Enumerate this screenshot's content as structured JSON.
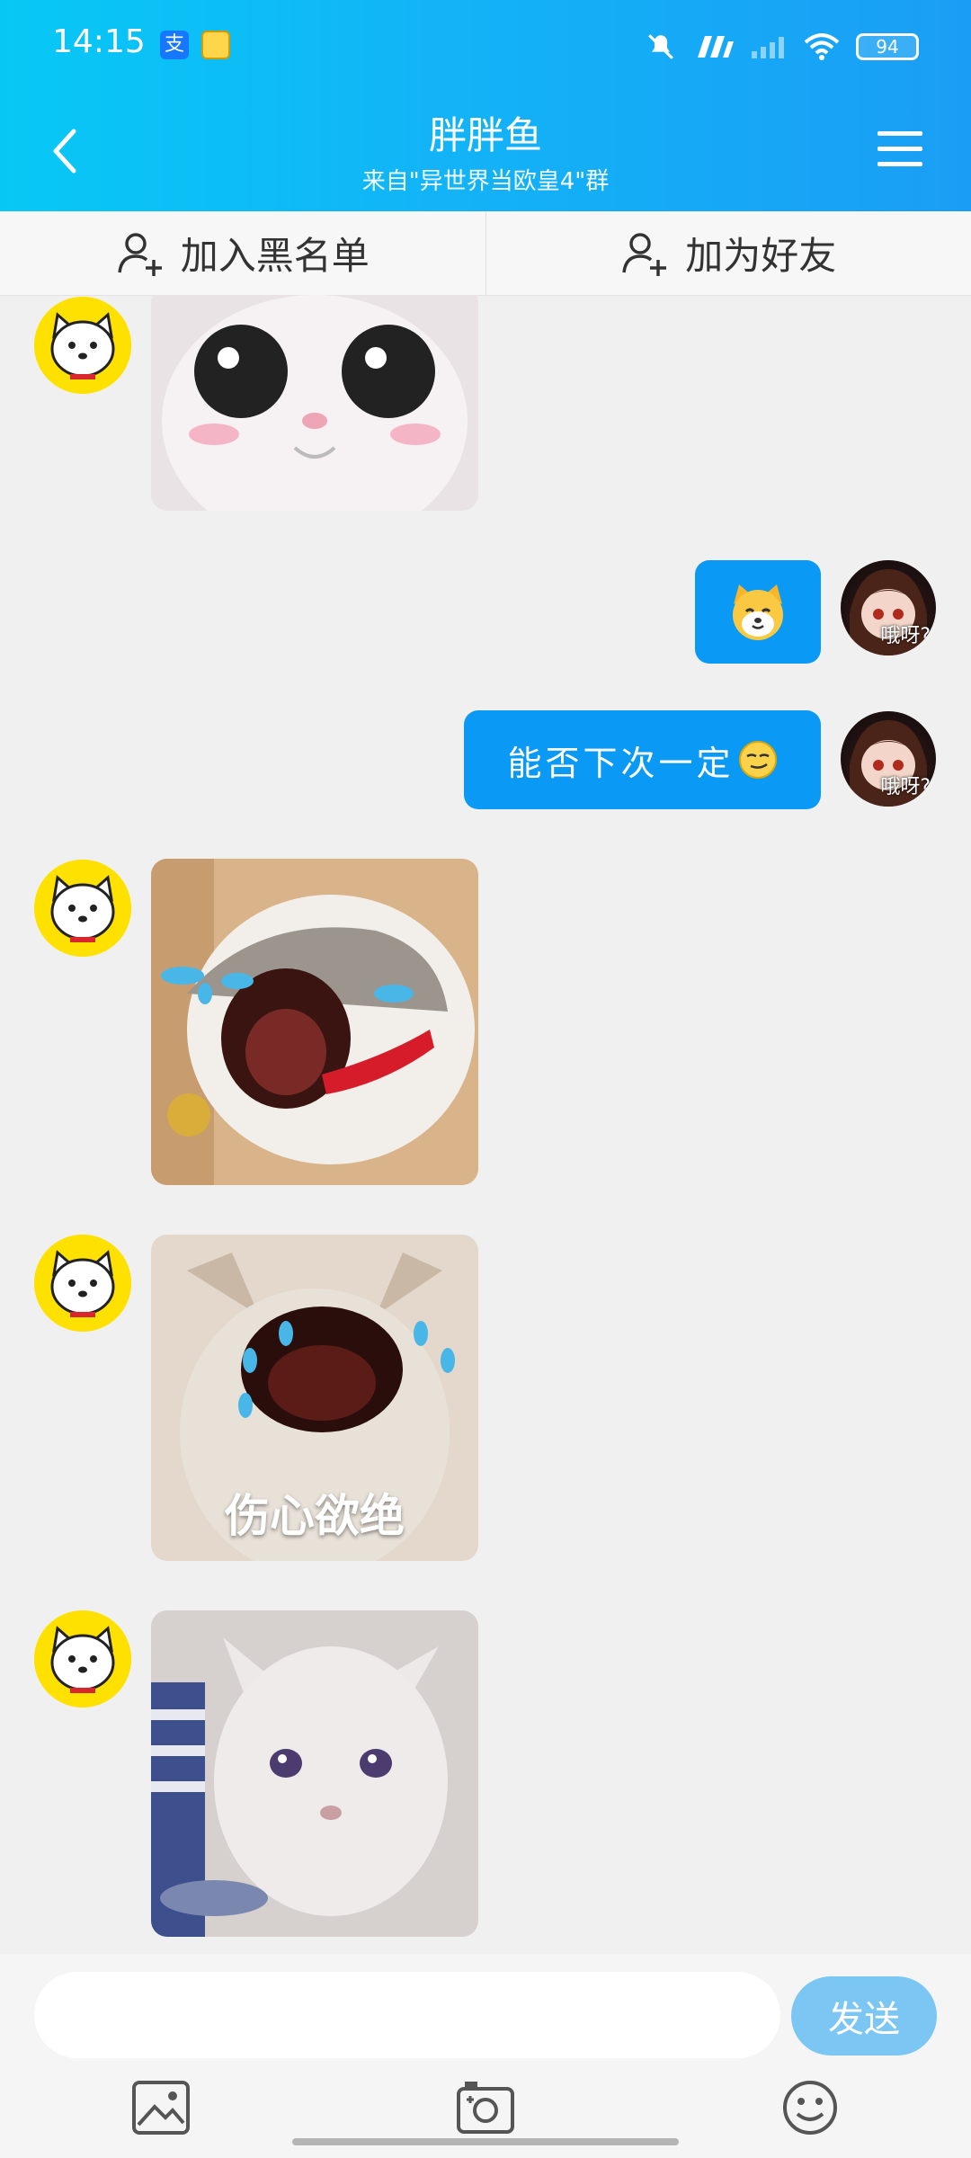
{
  "status_bar": {
    "time": "14:15",
    "battery": "94"
  },
  "header": {
    "title": "胖胖鱼",
    "subtitle": "来自\"异世界当欧皇4\"群",
    "back_icon": "chevron-left-icon",
    "menu_icon": "hamburger-menu-icon"
  },
  "actions": {
    "blacklist_label": "加入黑名单",
    "add_friend_label": "加为好友"
  },
  "messages": [
    {
      "sender": "other",
      "type": "image",
      "subject": "cat with big eyes"
    },
    {
      "sender": "self",
      "type": "sticker",
      "subject": "smiling yellow cat emoji"
    },
    {
      "sender": "self",
      "type": "text",
      "text": "能否下次一定"
    },
    {
      "sender": "other",
      "type": "image",
      "subject": "crying cat"
    },
    {
      "sender": "other",
      "type": "image",
      "subject": "crying cat",
      "caption": "伤心欲绝"
    },
    {
      "sender": "other",
      "type": "image",
      "subject": "sad cat"
    }
  ],
  "self_avatar": {
    "label": "哦呀?"
  },
  "composer": {
    "input_value": "",
    "send_label": "发送"
  },
  "toolbar": {
    "image_icon": "image-icon",
    "camera_icon": "camera-icon",
    "emoji_icon": "emoji-icon"
  },
  "colors": {
    "header_gradient_start": "#07c8f5",
    "header_gradient_end": "#1a9ef5",
    "bubble": "#0a99f5",
    "send_button": "#7cc6f4"
  }
}
